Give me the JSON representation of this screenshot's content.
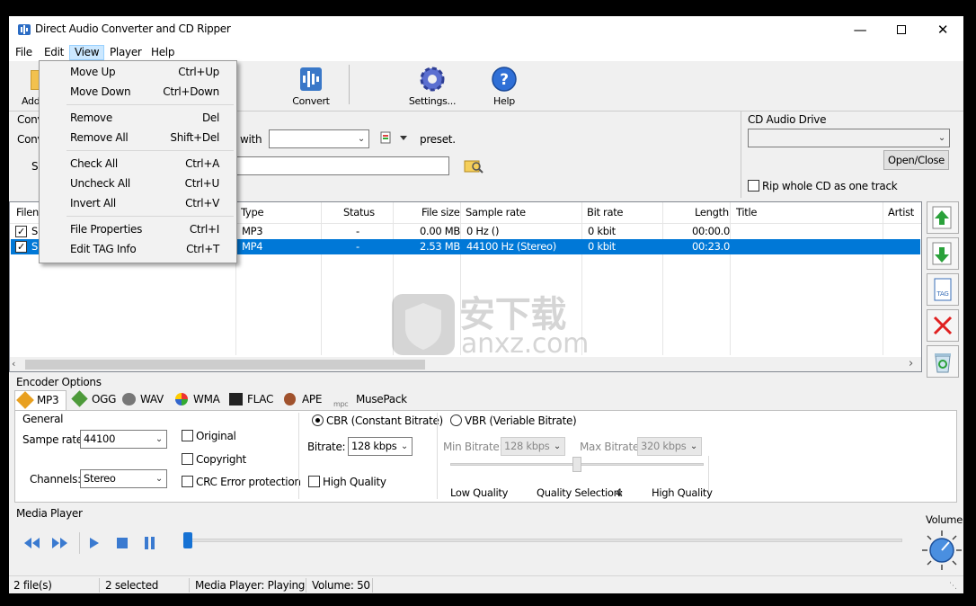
{
  "window": {
    "title": "Direct Audio Converter and CD Ripper"
  },
  "menu": [
    "File",
    "Edit",
    "View",
    "Player",
    "Help"
  ],
  "toolbar": {
    "add": "Add",
    "convert": "Convert",
    "settings": "Settings...",
    "help": "Help"
  },
  "convert_panel": {
    "label1": "Conv",
    "label2": "Conv",
    "label3": "S",
    "with_label": "with",
    "preset_label": "preset."
  },
  "cd": {
    "group_title": "CD Audio Drive",
    "open_close": "Open/Close",
    "rip_whole": "Rip whole CD as one track"
  },
  "table": {
    "headers": [
      "Filena",
      "Type",
      "Status",
      "File size",
      "Sample rate",
      "Bit rate",
      "Length",
      "Title",
      "Artist"
    ],
    "rows": [
      {
        "name": "S",
        "type": "MP3",
        "status": "-",
        "size": "0.00 MB",
        "rate": "0 Hz ()",
        "bitrate": "0 kbit",
        "length": "00:00.0",
        "title": "",
        "artist": "",
        "checked": true,
        "selected": false
      },
      {
        "name": "S",
        "type": "MP4",
        "status": "-",
        "size": "2.53 MB",
        "rate": "44100 Hz (Stereo)",
        "bitrate": "0 kbit",
        "length": "00:23.0",
        "title": "",
        "artist": "",
        "checked": true,
        "selected": true
      }
    ]
  },
  "encoder": {
    "title": "Encoder Options",
    "tabs": [
      "MP3",
      "OGG",
      "WAV",
      "WMA",
      "FLAC",
      "APE",
      "MusePack"
    ],
    "general_title": "General",
    "sample_rate_label": "Sampe rate:",
    "sample_rate": "44100",
    "channels_label": "Channels:",
    "channels": "Stereo",
    "original": "Original",
    "copyright": "Copyright",
    "crc": "CRC Error protection",
    "cbr": "CBR (Constant Bitrate)",
    "bitrate_label": "Bitrate:",
    "bitrate": "128 kbps",
    "high_quality": "High Quality",
    "vbr": "VBR (Veriable Bitrate)",
    "min_label": "Min Bitrate:",
    "min": "128 kbps",
    "max_label": "Max Bitrate:",
    "max": "320 kbps",
    "low_q": "Low Quality",
    "q_sel_label": "Quality Selection:",
    "q_sel": "4",
    "high_q": "High Quality",
    "quality_level": 0.5
  },
  "player": {
    "title": "Media Player",
    "volume_label": "Volume",
    "position": 0.0
  },
  "status": {
    "files": "2 file(s)",
    "selected": "2 selected",
    "player": "Media Player: Playing",
    "volume": "Volume: 50"
  },
  "view_menu": [
    {
      "label": "Move Up",
      "key": "Ctrl+Up"
    },
    {
      "label": "Move Down",
      "key": "Ctrl+Down"
    },
    {
      "label": "Remove",
      "key": "Del"
    },
    {
      "label": "Remove All",
      "key": "Shift+Del"
    },
    {
      "label": "Check All",
      "key": "Ctrl+A"
    },
    {
      "label": "Uncheck All",
      "key": "Ctrl+U"
    },
    {
      "label": "Invert All",
      "key": "Ctrl+V"
    },
    {
      "label": "File Properties",
      "key": "Ctrl+I"
    },
    {
      "label": "Edit TAG Info",
      "key": "Ctrl+T"
    }
  ],
  "watermark": {
    "cn": "安下载",
    "url": "anxz.com"
  }
}
